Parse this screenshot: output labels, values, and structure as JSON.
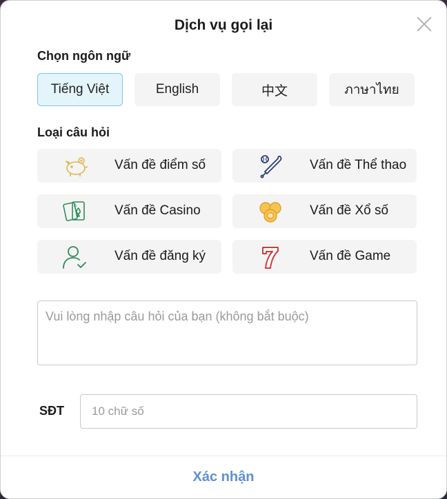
{
  "dialog": {
    "title": "Dịch vụ gọi lại"
  },
  "language_section": {
    "label": "Chọn ngôn ngữ",
    "options": [
      {
        "label": "Tiếng Việt",
        "selected": true
      },
      {
        "label": "English",
        "selected": false
      },
      {
        "label": "中文",
        "selected": false
      },
      {
        "label": "ภาษาไทย",
        "selected": false
      }
    ]
  },
  "question_section": {
    "label": "Loại câu hỏi",
    "options": [
      {
        "label": "Vấn đề điểm số",
        "icon": "piggy-bank-icon"
      },
      {
        "label": "Vấn đề Thể thao",
        "icon": "baseball-bat-icon"
      },
      {
        "label": "Vấn đề Casino",
        "icon": "playing-cards-icon"
      },
      {
        "label": "Vấn đề Xổ số",
        "icon": "lottery-balls-icon"
      },
      {
        "label": "Vấn đề đăng ký",
        "icon": "user-check-icon"
      },
      {
        "label": "Vấn đề Game",
        "icon": "slot-seven-icon"
      }
    ]
  },
  "question_input": {
    "placeholder": "Vui lòng nhập câu hỏi của bạn (không bắt buộc)",
    "value": ""
  },
  "phone": {
    "label": "SĐT",
    "placeholder": "10 chữ số",
    "value": ""
  },
  "submit_label": "Xác nhận",
  "colors": {
    "accent": "#5d8fd6",
    "selected_bg": "#e4f4fb",
    "selected_border": "#7cc6e2",
    "icon_gold": "#e2b54a",
    "icon_green": "#2e8b57",
    "icon_navy": "#2f3f73",
    "icon_red": "#d63a3a"
  }
}
